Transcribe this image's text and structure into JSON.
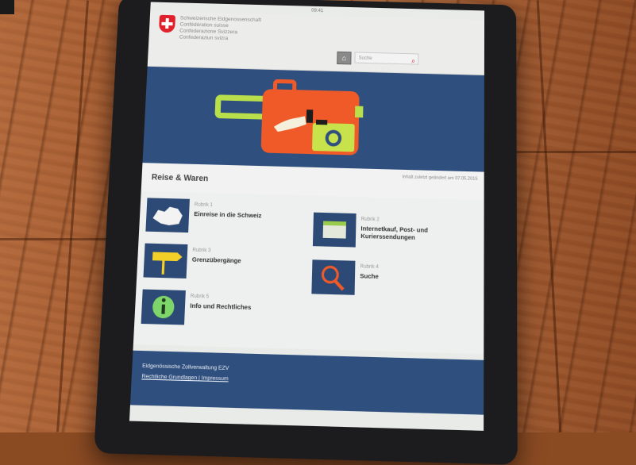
{
  "header": {
    "status_time": "09:41",
    "confederation_lines": [
      "Schweizerische Eidgenossenschaft",
      "Confédération suisse",
      "Confederazione Svizzera",
      "Confederaziun svizra"
    ],
    "search_placeholder": "Suche"
  },
  "page": {
    "title": "Reise & Waren",
    "updated": "Inhalt zuletzt geändert am 07.05.2015"
  },
  "items": [
    {
      "rubrik": "Rubrik 1",
      "label": "Einreise in die Schweiz",
      "icon": "swiss-map-icon"
    },
    {
      "rubrik": "Rubrik 2",
      "label": "Internetkauf, Post- und Kurierssendungen",
      "icon": "package-icon"
    },
    {
      "rubrik": "Rubrik 3",
      "label": "Grenzübergänge",
      "icon": "signpost-icon"
    },
    {
      "rubrik": "Rubrik 4",
      "label": "Suche",
      "icon": "magnifier-icon"
    },
    {
      "rubrik": "Rubrik 5",
      "label": "Info und Rechtliches",
      "icon": "info-icon"
    }
  ],
  "footer": {
    "org": "Eidgenössische Zollverwaltung EZV",
    "links": "Rechtliche Grundlagen | Impressum"
  },
  "colors": {
    "navy": "#2f4f7e",
    "orange": "#f05a28",
    "lime": "#b9e04a",
    "swiss_red": "#e0212b"
  }
}
